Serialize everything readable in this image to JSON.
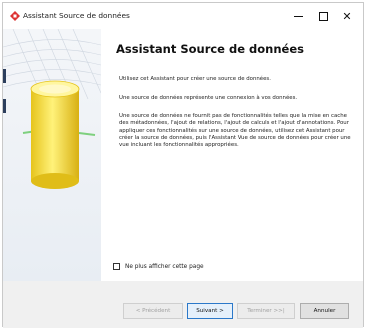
{
  "window": {
    "title": "Assistant Source de données"
  },
  "main": {
    "heading": "Assistant Source de données",
    "paragraphs": [
      "Utilisez cet Assistant pour créer une source de données.",
      "Une source de données représente une connexion à vos données.",
      "Une source de données ne fournit pas de fonctionnalités telles que la mise en cache des métadonnées, l'ajout de relations, l'ajout de calculs et l'ajout d'annotations. Pour appliquer ces fonctionnalités sur une source de données, utilisez cet Assistant pour créer la source de données, puis l'Assistant Vue de source de données pour créer une vue incluant les fonctionnalités appropriées."
    ],
    "dont_show_label": "Ne plus afficher cette page",
    "dont_show_checked": false
  },
  "buttons": {
    "previous": "< Précédent",
    "next": "Suivant >",
    "finish": "Terminer >>|",
    "cancel": "Annuler"
  },
  "colors": {
    "cylinder": "#f2dc3a",
    "focus_border": "#2b78c9"
  }
}
